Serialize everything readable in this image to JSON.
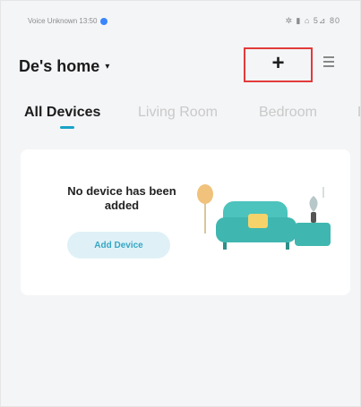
{
  "status_bar": {
    "carrier_text": "Voice Unknown 13:50",
    "right_indicators": "✲ ▮ ⌂ 5⊿ 80"
  },
  "header": {
    "home_name": "De's home",
    "dropdown_caret": "▾",
    "add_icon": "+",
    "menu_icon": "hamburger-icon"
  },
  "tabs": [
    {
      "label": "All Devices",
      "active": true
    },
    {
      "label": "Living Room",
      "active": false
    },
    {
      "label": "Bedroom",
      "active": false
    },
    {
      "label": "D",
      "active": false
    }
  ],
  "empty_state": {
    "message": "No device has been added",
    "button_label": "Add Device"
  },
  "colors": {
    "accent": "#1aa3c7",
    "highlight_box": "#e23a3a",
    "sofa": "#3fb7b0",
    "lamp": "#f0c27b",
    "background": "#f4f5f7"
  }
}
